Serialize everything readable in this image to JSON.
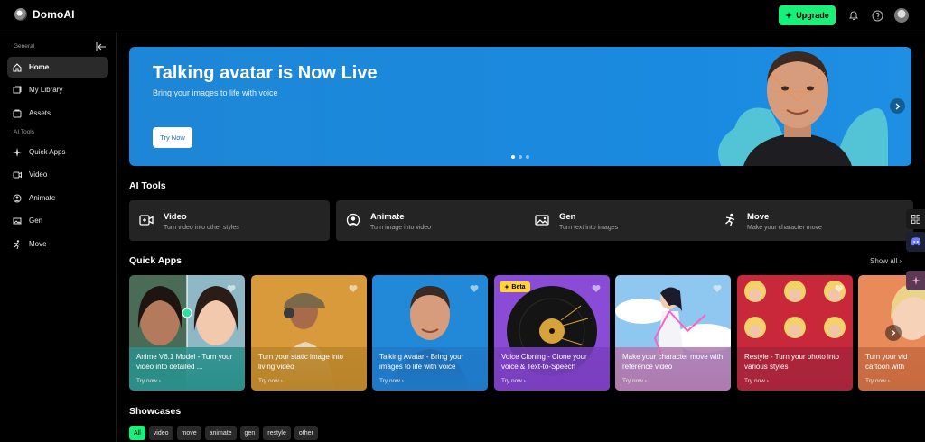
{
  "app": {
    "name": "DomoAI"
  },
  "header": {
    "upgrade_label": "Upgrade"
  },
  "sidebar": {
    "general_label": "General",
    "ai_tools_label": "AI Tools",
    "items": [
      {
        "label": "Home",
        "icon": "home-icon",
        "active": true
      },
      {
        "label": "My Library",
        "icon": "library-icon"
      },
      {
        "label": "Assets",
        "icon": "assets-icon"
      },
      {
        "label": "Quick Apps",
        "icon": "sparkle-icon"
      },
      {
        "label": "Video",
        "icon": "video-icon"
      },
      {
        "label": "Animate",
        "icon": "animate-icon"
      },
      {
        "label": "Gen",
        "icon": "image-icon"
      },
      {
        "label": "Move",
        "icon": "move-icon"
      }
    ]
  },
  "banner": {
    "title": "Talking avatar is Now Live",
    "subtitle": "Bring your images to life with voice",
    "cta": "Try Now",
    "slide_index": 1,
    "slide_count": 3
  },
  "ai_tools": {
    "heading": "AI Tools",
    "items": [
      {
        "title": "Video",
        "sub": "Turn video into other styles",
        "icon": "video-icon"
      },
      {
        "title": "Animate",
        "sub": "Turn image into video",
        "icon": "animate-icon"
      },
      {
        "title": "Gen",
        "sub": "Turn text into images",
        "icon": "image-icon"
      },
      {
        "title": "Move",
        "sub": "Make your character move",
        "icon": "move-icon"
      }
    ]
  },
  "quick_apps": {
    "heading": "Quick Apps",
    "show_all": "Show all",
    "try_label": "Try now",
    "beta_label": "Beta",
    "cards": [
      {
        "title": "Anime V6.1 Model - Turn your video into detailed ...",
        "foot_color": "#2a8f8a"
      },
      {
        "title": "Turn your static image into living video",
        "foot_color": "#b9842a"
      },
      {
        "title": "Talking Avatar - Bring your images to life with voice",
        "foot_color": "#1f79c8"
      },
      {
        "title": "Voice Cloning - Clone your voice & Text-to-Speech",
        "foot_color": "#7a3ec0",
        "beta": true
      },
      {
        "title": "Make your character move with reference video",
        "foot_color": "#b07ab0"
      },
      {
        "title": "Restyle - Turn your photo into various styles",
        "foot_color": "#a8243a"
      },
      {
        "title": "Turn your vid cartoon with",
        "foot_color": "#c76a40"
      }
    ]
  },
  "showcases": {
    "heading": "Showcases",
    "chips": [
      "All",
      "video",
      "move",
      "animate",
      "gen",
      "restyle",
      "other"
    ]
  },
  "colors": {
    "accent": "#19f07a",
    "banner": "#1a8ae0",
    "card": "#242424"
  }
}
